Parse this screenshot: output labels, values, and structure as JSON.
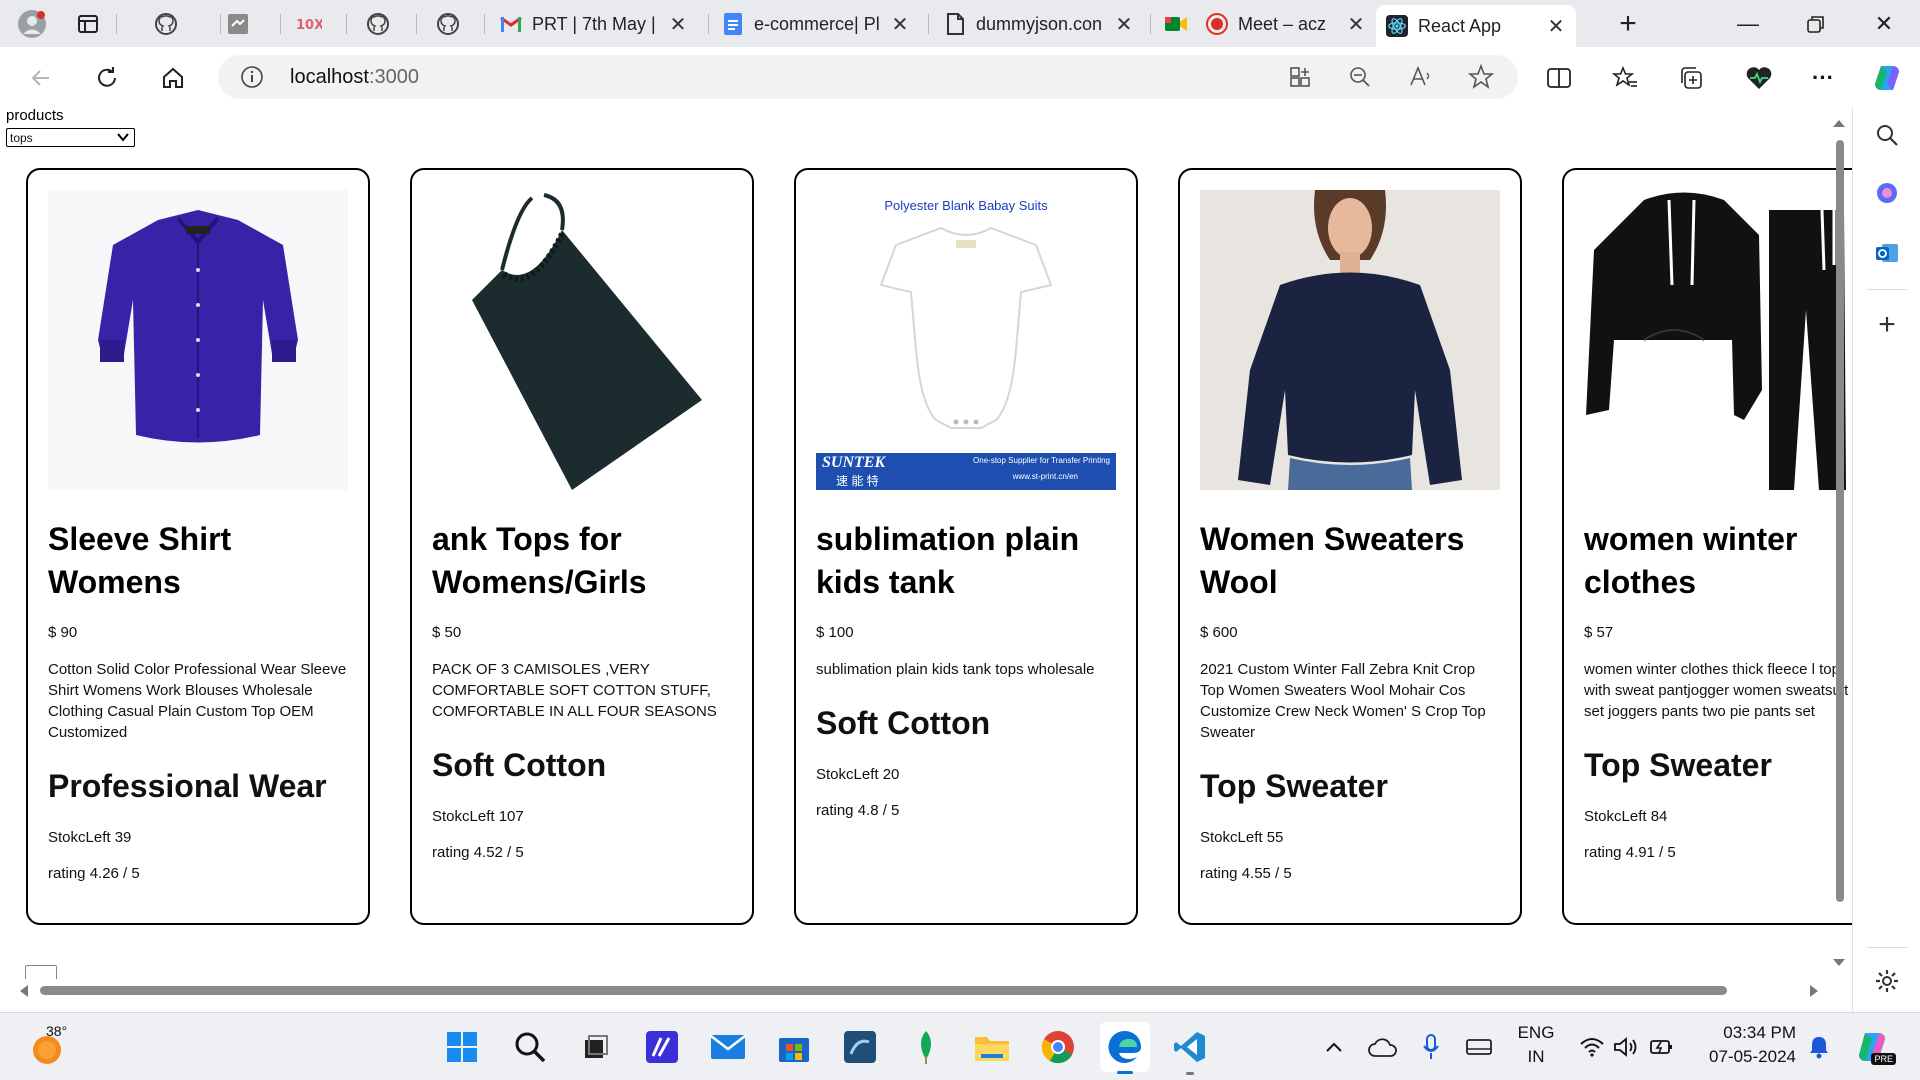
{
  "browser": {
    "tabs": [
      {
        "title": "PRT | 7th May |",
        "icon": "gmail-icon"
      },
      {
        "title": "e-commerce| Pl",
        "icon": "google-docs-icon"
      },
      {
        "title": "dummyjson.con",
        "icon": "page-icon"
      },
      {
        "title": "Meet – acz",
        "icon": "meet-icon"
      },
      {
        "title": "React App",
        "icon": "react-icon",
        "active": true
      }
    ],
    "url_host": "localhost",
    "url_port": ":3000"
  },
  "page": {
    "products_label": "products",
    "category_selected": "tops"
  },
  "products": [
    {
      "title": "Sleeve Shirt Womens",
      "price": "$ 90",
      "description": "Cotton Solid Color Professional Wear Sleeve Shirt Womens Work Blouses Wholesale Clothing Casual Plain Custom Top OEM Customized",
      "brand": "Professional Wear",
      "stock": "StokcLeft 39",
      "rating": "rating 4.26 / 5"
    },
    {
      "title": "ank Tops for Womens/Girls",
      "price": "$ 50",
      "description": "PACK OF 3 CAMISOLES ,VERY COMFORTABLE SOFT COTTON STUFF, COMFORTABLE IN ALL FOUR SEASONS",
      "brand": "Soft Cotton",
      "stock": "StokcLeft 107",
      "rating": "rating 4.52 / 5"
    },
    {
      "title": "sublimation plain kids tank",
      "price": "$ 100",
      "description": "sublimation plain kids tank tops wholesale",
      "brand": "Soft Cotton",
      "stock": "StokcLeft 20",
      "rating": "rating 4.8 / 5",
      "image_caption": "Polyester Blank Babay Suits",
      "image_banner": "SUNTEK",
      "image_banner_cn": "速 能 特",
      "image_banner_text": "One-stop Supplier for Transfer Printing",
      "image_banner_url": "www.st-print.cn/en"
    },
    {
      "title": "Women Sweaters Wool",
      "price": "$ 600",
      "description": "2021 Custom Winter Fall Zebra Knit Crop Top Women Sweaters Wool Mohair Cos Customize Crew Neck Women' S Crop Top Sweater",
      "brand": "Top Sweater",
      "stock": "StokcLeft 55",
      "rating": "rating 4.55 / 5"
    },
    {
      "title": "women winter clothes",
      "price": "$ 57",
      "description": "women winter clothes thick fleece l top with sweat pantjogger women sweatsuit set joggers pants two pie pants set",
      "brand": "Top Sweater",
      "stock": "StokcLeft 84",
      "rating": "rating 4.91 / 5"
    }
  ],
  "taskbar": {
    "weather_temp": "38°",
    "lang_line1": "ENG",
    "lang_line2": "IN",
    "time": "03:34 PM",
    "date": "07-05-2024",
    "copilot_badge": "PRE"
  },
  "colors": {
    "shirt": "#3a22a8",
    "tank": "#1c2b2e",
    "sweater": "#1a2340",
    "hoodie": "#111111",
    "edge_blue": "#0b6fd6"
  }
}
